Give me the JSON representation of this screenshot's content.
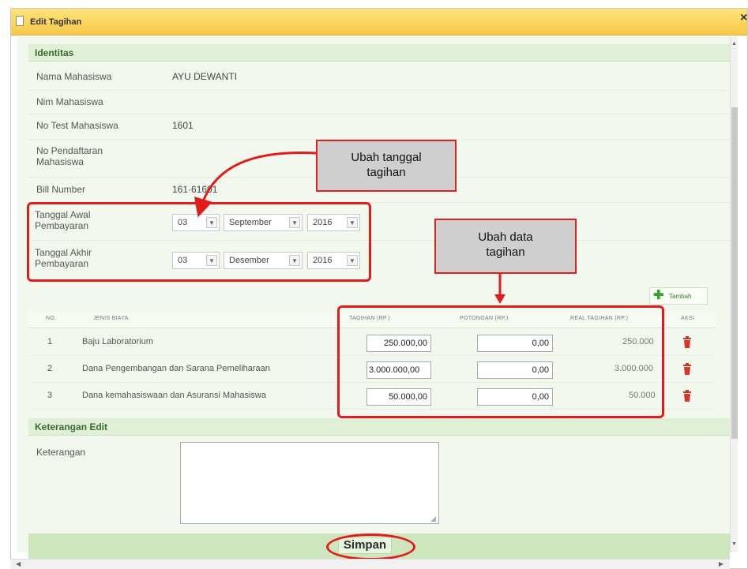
{
  "dialog": {
    "title": "Edit Tagihan",
    "close_glyph": "×"
  },
  "identitas": {
    "heading": "Identitas",
    "nama_label": "Nama Mahasiswa",
    "nama_value": "AYU DEWANTI",
    "nim_label": "Nim Mahasiswa",
    "nim_value": "",
    "notest_label": "No Test Mahasiswa",
    "notest_value": "1601",
    "pendaftaran_label_1": "No Pendaftaran",
    "pendaftaran_label_2": "Mahasiswa",
    "bill_label": "Bill Number",
    "bill_value": "161·61601",
    "awal_label_1": "Tanggal Awal",
    "awal_label_2": "Pembayaran",
    "akhir_label_1": "Tanggal Akhir",
    "akhir_label_2": "Pembayaran",
    "awal_day": "03",
    "awal_month": "September",
    "awal_year": "2016",
    "akhir_day": "03",
    "akhir_month": "Desember",
    "akhir_year": "2016"
  },
  "callouts": {
    "tanggal_1": "Ubah tanggal",
    "tanggal_2": "tagihan",
    "data_1": "Ubah data",
    "data_2": "tagihan"
  },
  "table": {
    "add_label": "Tambah",
    "headers": [
      "NO.",
      "JENIS BIAYA",
      "TAGIHAN (RP.)",
      "POTONGAN (RP.)",
      "REAL TAGIHAN (RP.)",
      "AKSI"
    ],
    "rows": [
      {
        "no": "1",
        "jenis": "Baju Laboratorium",
        "tagihan": "250.000,00",
        "potongan": "0,00",
        "real": "250.000"
      },
      {
        "no": "2",
        "jenis": "Dana Pengembangan dan Sarana Pemeliharaan",
        "tagihan": "3.000.000,00",
        "potongan": "0,00",
        "real": "3.000.000"
      },
      {
        "no": "3",
        "jenis": "Dana kemahasiswaan dan Asuransi Mahasiswa",
        "tagihan": "50.000,00",
        "potongan": "0,00",
        "real": "50.000"
      }
    ]
  },
  "keterangan": {
    "heading": "Keterangan Edit",
    "label": "Keterangan",
    "value": ""
  },
  "footer": {
    "save_label": "Simpan"
  },
  "colors": {
    "accent_red": "#e21b1b",
    "header_yellow": "#f7c84a",
    "section_green": "#dff0d6"
  }
}
